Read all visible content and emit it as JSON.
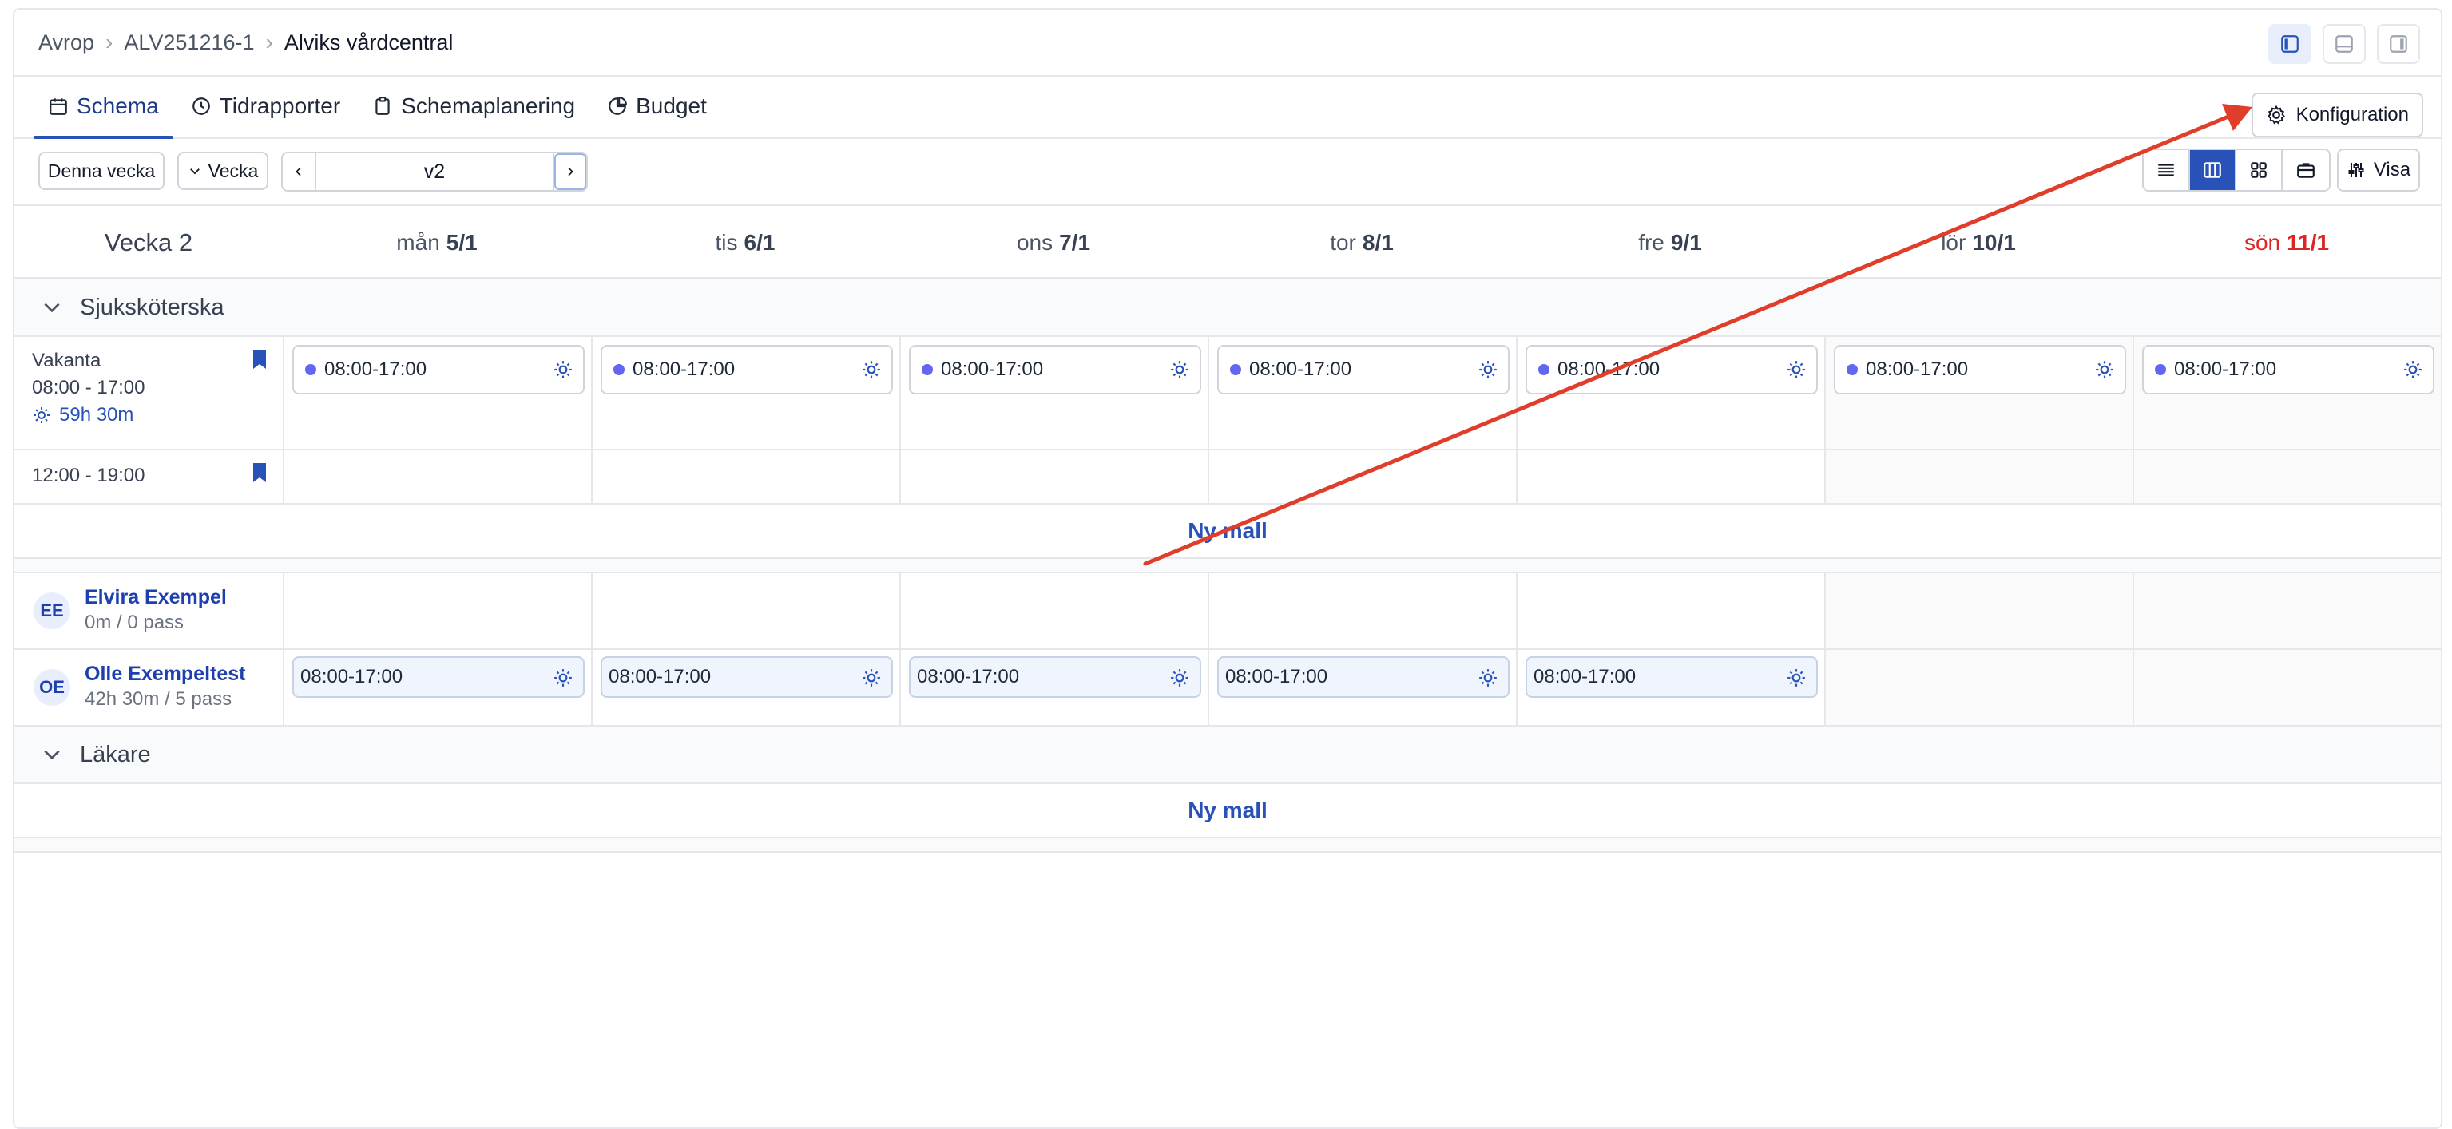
{
  "breadcrumb": {
    "items": [
      "Avrop",
      "ALV251216-1"
    ],
    "current": "Alviks vårdcentral"
  },
  "tabs": [
    {
      "label": "Schema",
      "icon": "calendar-icon",
      "active": true
    },
    {
      "label": "Tidrapporter",
      "icon": "clock-icon"
    },
    {
      "label": "Schemaplanering",
      "icon": "clipboard-icon"
    },
    {
      "label": "Budget",
      "icon": "pie-chart-icon"
    }
  ],
  "config_label": "Konfiguration",
  "toolbar": {
    "this_week": "Denna vecka",
    "period": "Vecka",
    "week_value": "v2",
    "visa": "Visa"
  },
  "week_label": "Vecka 2",
  "days": [
    {
      "name": "mån",
      "date": "5/1"
    },
    {
      "name": "tis",
      "date": "6/1"
    },
    {
      "name": "ons",
      "date": "7/1"
    },
    {
      "name": "tor",
      "date": "8/1"
    },
    {
      "name": "fre",
      "date": "9/1"
    },
    {
      "name": "lör",
      "date": "10/1"
    },
    {
      "name": "sön",
      "date": "11/1"
    }
  ],
  "sections": [
    {
      "title": "Sjuksköterska"
    },
    {
      "title": "Läkare"
    }
  ],
  "vacant": {
    "title": "Vakanta",
    "time": "08:00 - 17:00",
    "hours": "59h 30m",
    "shift": "08:00-17:00",
    "second_time": "12:00 - 19:00"
  },
  "nymall_label": "Ny mall",
  "people": [
    {
      "initials": "EE",
      "name": "Elvira Exempel",
      "summary": "0m / 0 pass",
      "shifts": []
    },
    {
      "initials": "OE",
      "name": "Olle Exempeltest",
      "summary": "42h 30m / 5 pass",
      "shifts": [
        "08:00-17:00",
        "08:00-17:00",
        "08:00-17:00",
        "08:00-17:00",
        "08:00-17:00"
      ]
    }
  ],
  "colors": {
    "accent": "#2952b8",
    "sunday": "#dc2626",
    "shift_dot": "#6366f1",
    "annotation_arrow": "#e03d2a"
  }
}
